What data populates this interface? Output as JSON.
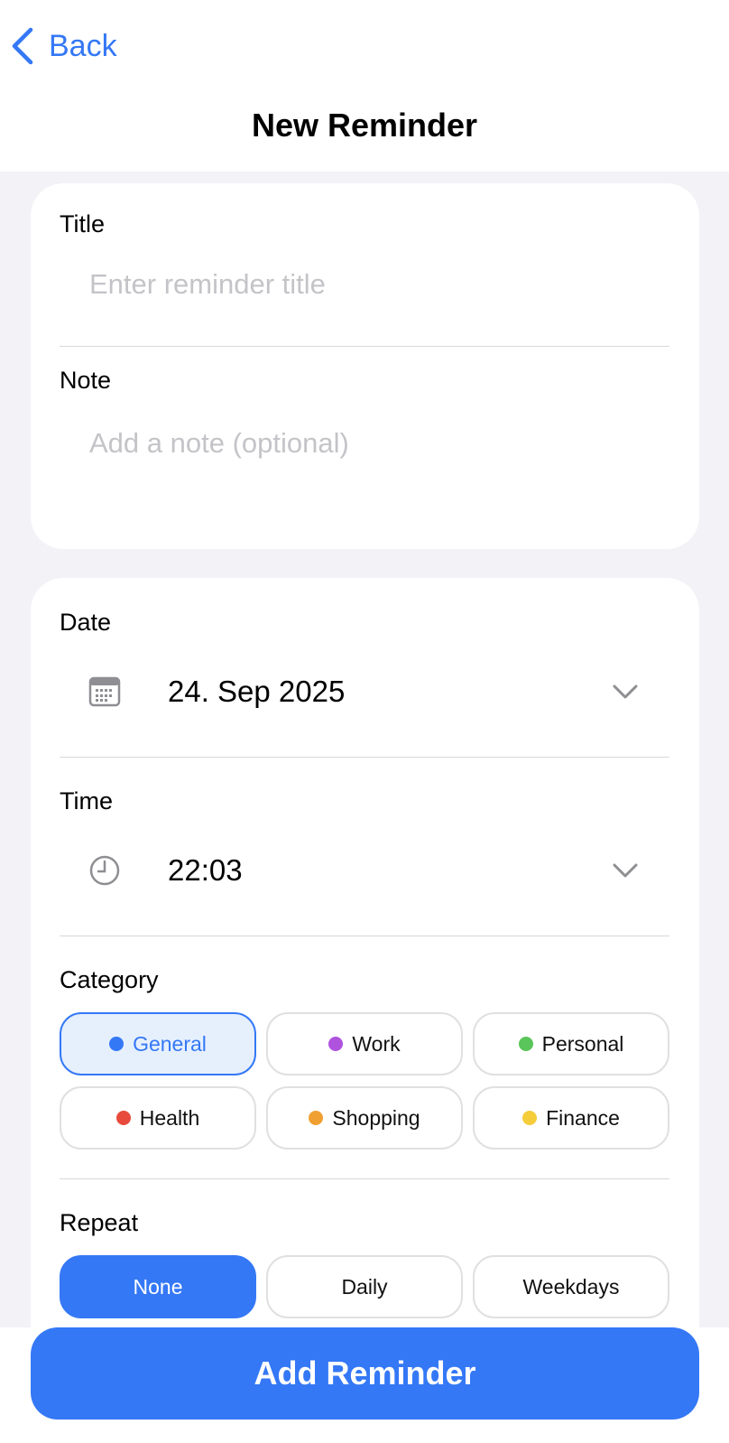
{
  "nav": {
    "back_label": "Back",
    "title": "New Reminder",
    "back_icon": "chevron-left-icon"
  },
  "form": {
    "title": {
      "label": "Title",
      "placeholder": "Enter reminder title",
      "value": ""
    },
    "note": {
      "label": "Note",
      "placeholder": "Add a note (optional)",
      "value": ""
    },
    "date": {
      "label": "Date",
      "value": "24. Sep 2025",
      "icon": "calendar-icon"
    },
    "time": {
      "label": "Time",
      "value": "22:03",
      "icon": "clock-icon"
    },
    "category": {
      "label": "Category",
      "selected": "General",
      "options": [
        {
          "label": "General",
          "color": "#3478f6"
        },
        {
          "label": "Work",
          "color": "#af52de"
        },
        {
          "label": "Personal",
          "color": "#5ac55a"
        },
        {
          "label": "Health",
          "color": "#e84b3c"
        },
        {
          "label": "Shopping",
          "color": "#f0a030"
        },
        {
          "label": "Finance",
          "color": "#f5cc3a"
        }
      ]
    },
    "repeat": {
      "label": "Repeat",
      "selected": "None",
      "options": [
        "None",
        "Daily",
        "Weekdays"
      ]
    }
  },
  "actions": {
    "add_label": "Add Reminder"
  },
  "colors": {
    "accent": "#3478f6",
    "background": "#f2f2f7"
  }
}
